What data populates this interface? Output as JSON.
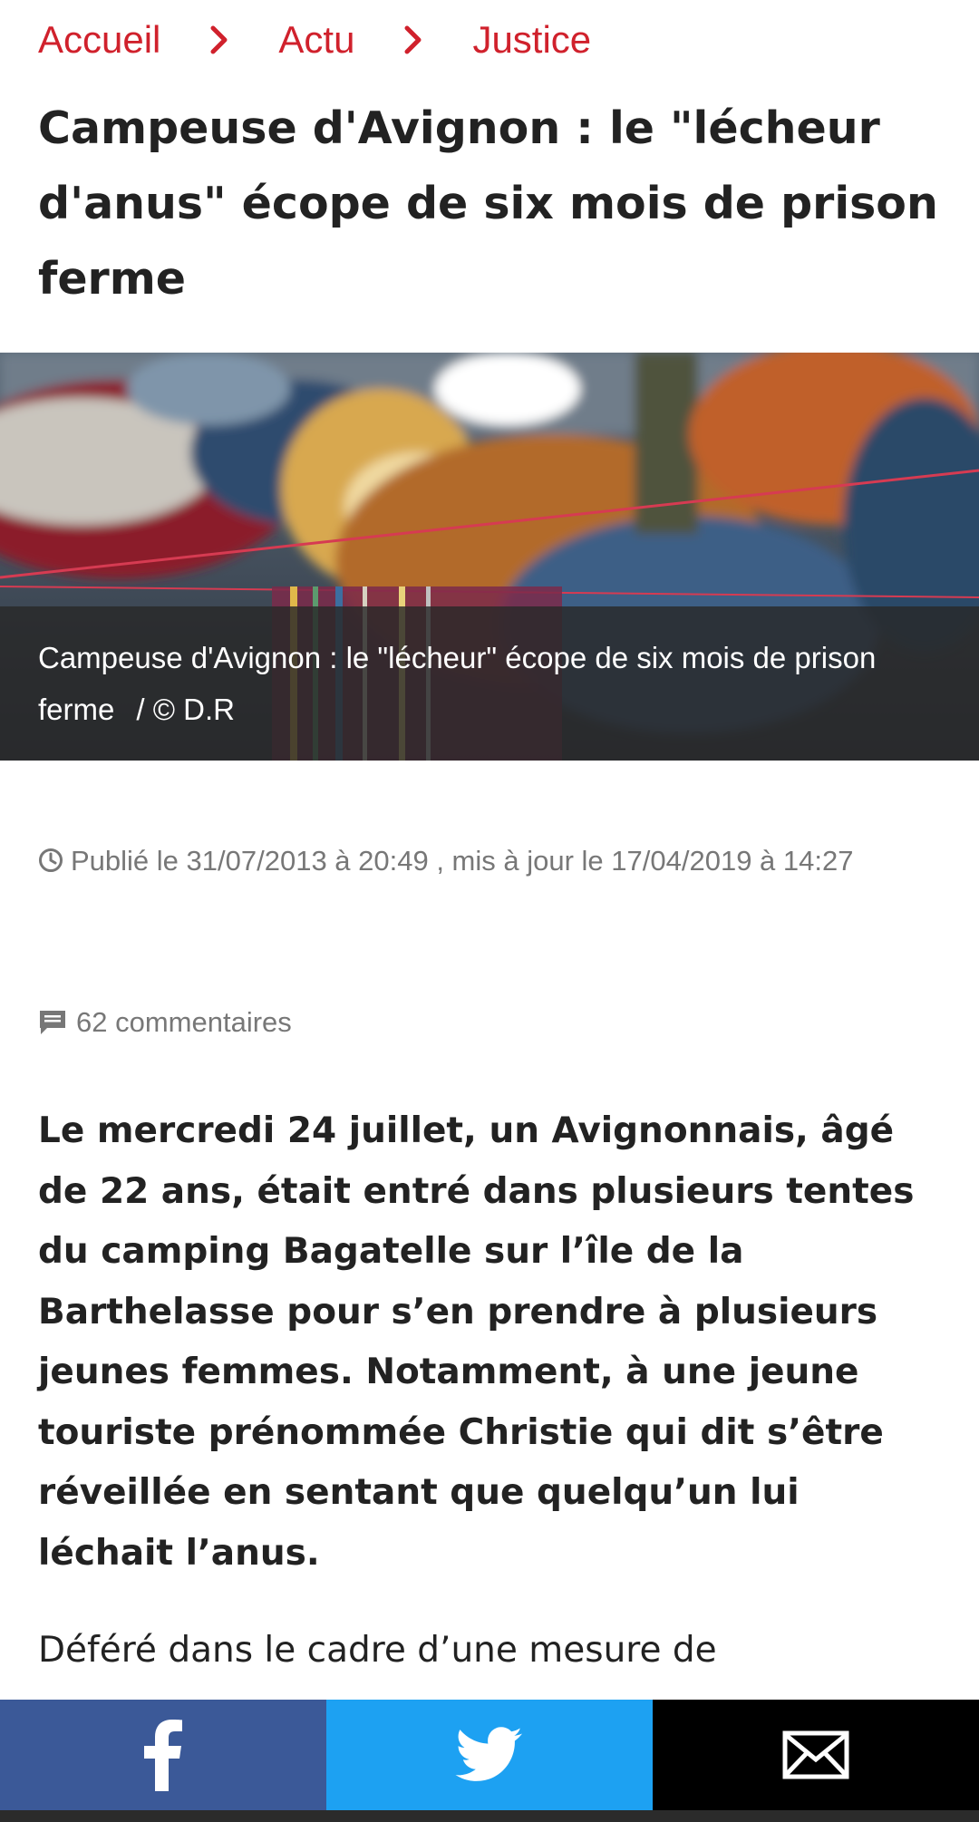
{
  "breadcrumb": {
    "items": [
      "Accueil",
      "Actu",
      "Justice"
    ],
    "separator_icon": "chevron-right-icon"
  },
  "article": {
    "title": "Campeuse d'Avignon : le \"lécheur d'anus\" écope de six mois de prison ferme",
    "image": {
      "caption": "Campeuse d'Avignon : le \"lécheur\" écope de six mois de prison ferme",
      "credit": "/ © D.R"
    },
    "published": "Publié le 31/07/2013 à 20:49 , mis à jour le 17/04/2019 à 14:27",
    "comments": "62 commentaires",
    "lead": "Le mercredi 24 juillet, un Avignonnais, âgé de 22 ans, était entré dans plusieurs tentes du camping Bagatelle sur l’île de la Barthelasse pour s’en prendre à plusieurs jeunes femmes. Notamment, à une jeune touriste prénommée Christie qui dit s’être réveillée en sentant que quelqu’un lui léchait l’anus.",
    "paragraph": "Déféré dans le cadre d’une mesure de"
  },
  "share": {
    "facebook_icon": "facebook-icon",
    "twitter_icon": "twitter-icon",
    "mail_icon": "mail-icon"
  },
  "colors": {
    "accent": "#d0212c",
    "facebook": "#3b5998",
    "twitter": "#1da1f2",
    "mail": "#000000",
    "meta_text": "#777777"
  }
}
